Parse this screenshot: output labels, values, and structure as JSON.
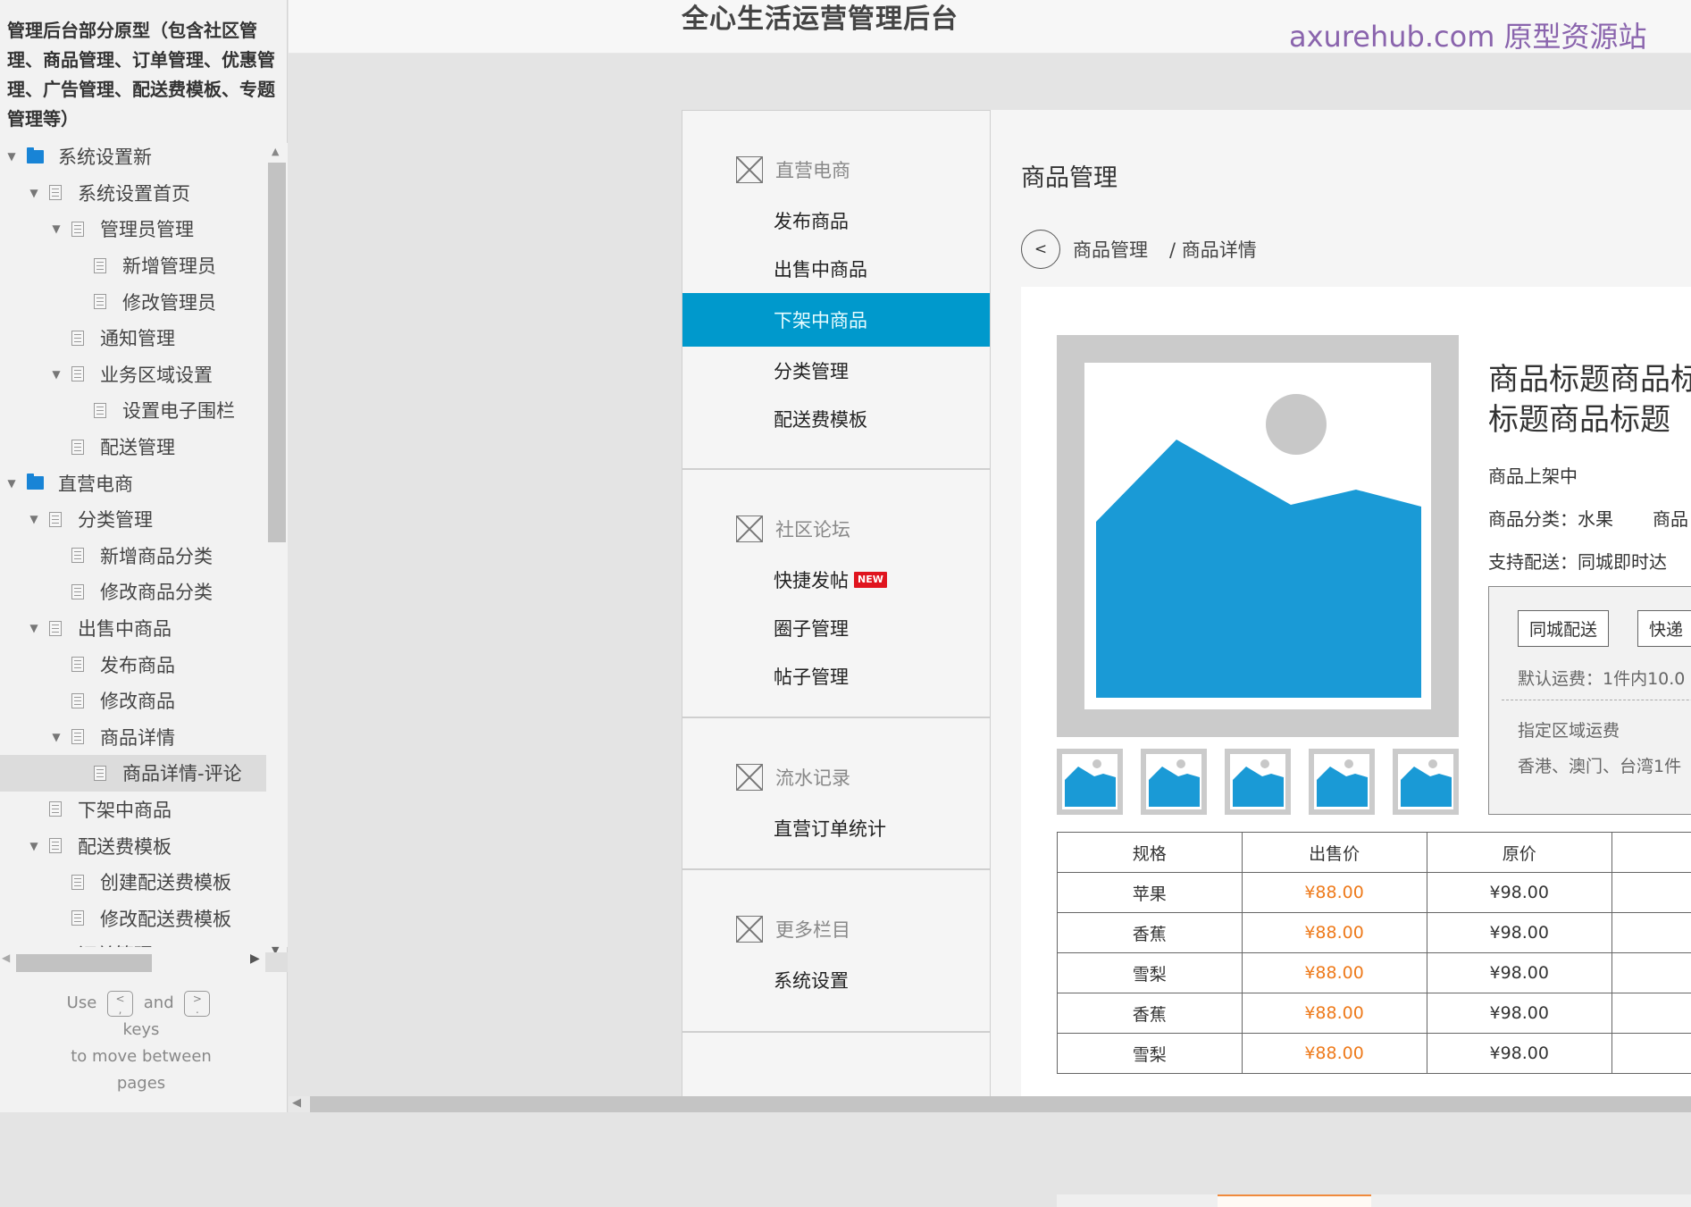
{
  "sitemap": {
    "title": "管理后台部分原型（包含社区管理、商品管理、订单管理、优惠管理、广告管理、配送费模板、专题管理等）",
    "items": [
      {
        "label": "系统设置新",
        "level": 0,
        "type": "folder",
        "expanded": true
      },
      {
        "label": "系统设置首页",
        "level": 1,
        "type": "page",
        "expanded": true
      },
      {
        "label": "管理员管理",
        "level": 2,
        "type": "page",
        "expanded": true
      },
      {
        "label": "新增管理员",
        "level": 3,
        "type": "page"
      },
      {
        "label": "修改管理员",
        "level": 3,
        "type": "page"
      },
      {
        "label": "通知管理",
        "level": 2,
        "type": "page"
      },
      {
        "label": "业务区域设置",
        "level": 2,
        "type": "page",
        "expanded": true
      },
      {
        "label": "设置电子围栏",
        "level": 3,
        "type": "page"
      },
      {
        "label": "配送管理",
        "level": 2,
        "type": "page"
      },
      {
        "label": "直营电商",
        "level": 0,
        "type": "folder",
        "expanded": true
      },
      {
        "label": "分类管理",
        "level": 1,
        "type": "page",
        "expanded": true
      },
      {
        "label": "新增商品分类",
        "level": 2,
        "type": "page"
      },
      {
        "label": "修改商品分类",
        "level": 2,
        "type": "page"
      },
      {
        "label": "出售中商品",
        "level": 1,
        "type": "page",
        "expanded": true
      },
      {
        "label": "发布商品",
        "level": 2,
        "type": "page"
      },
      {
        "label": "修改商品",
        "level": 2,
        "type": "page"
      },
      {
        "label": "商品详情",
        "level": 2,
        "type": "page",
        "expanded": true
      },
      {
        "label": "商品详情-评论",
        "level": 3,
        "type": "page",
        "selected": true
      },
      {
        "label": "下架中商品",
        "level": 1,
        "type": "page"
      },
      {
        "label": "配送费模板",
        "level": 1,
        "type": "page",
        "expanded": true
      },
      {
        "label": "创建配送费模板",
        "level": 2,
        "type": "page"
      },
      {
        "label": "修改配送费模板",
        "level": 2,
        "type": "page"
      },
      {
        "label": "订单管理",
        "level": 1,
        "type": "page",
        "expanded": true
      }
    ],
    "hint": {
      "use": "Use",
      "key_prev_top": "<",
      "key_prev_bottom": ",",
      "and": "and",
      "key_next_top": ">",
      "key_next_bottom": ".",
      "keys": "keys",
      "move": "to move between",
      "pages": "pages"
    }
  },
  "header": {
    "app_title": "全心生活运营管理后台",
    "watermark": "axurehub.com 原型资源站"
  },
  "nav": {
    "sections": [
      {
        "title": "直营电商",
        "items": [
          {
            "label": "发布商品"
          },
          {
            "label": "出售中商品"
          },
          {
            "label": "下架中商品",
            "active": true
          },
          {
            "label": "分类管理"
          },
          {
            "label": "配送费模板"
          }
        ]
      },
      {
        "title": "社区论坛",
        "items": [
          {
            "label": "快捷发帖",
            "badge": "NEW"
          },
          {
            "label": "圈子管理"
          },
          {
            "label": "帖子管理"
          }
        ]
      },
      {
        "title": "流水记录",
        "items": [
          {
            "label": "直营订单统计"
          }
        ]
      },
      {
        "title": "更多栏目",
        "items": [
          {
            "label": "系统设置"
          }
        ]
      }
    ]
  },
  "content": {
    "page_title": "商品管理",
    "breadcrumb": {
      "back_icon": "<",
      "parent": "商品管理",
      "current": "/ 商品详情"
    },
    "product": {
      "title_line1": "商品标题商品标",
      "title_line2": "标题商品标题",
      "status": "商品上架中",
      "category_label": "商品分类：",
      "category_value": "水果",
      "category_extra": "商品",
      "delivery_label": "支持配送：",
      "delivery_value": "同城即时达"
    },
    "shipping": {
      "tabs": [
        "同城配送",
        "快递"
      ],
      "default_fee": "默认运费：1件内10.0",
      "area_label": "指定区域运费",
      "area_value": "香港、澳门、台湾1件"
    },
    "spec_table": {
      "headers": [
        "规格",
        "出售价",
        "原价",
        ""
      ],
      "rows": [
        [
          "苹果",
          "¥88.00",
          "¥98.00",
          ""
        ],
        [
          "香蕉",
          "¥88.00",
          "¥98.00",
          ""
        ],
        [
          "雪梨",
          "¥88.00",
          "¥98.00",
          ""
        ],
        [
          "香蕉",
          "¥88.00",
          "¥98.00",
          ""
        ],
        [
          "雪梨",
          "¥88.00",
          "¥98.00",
          ""
        ]
      ]
    },
    "thumbnail_count": 5
  },
  "colors": {
    "accent": "#0099cc",
    "price": "#ee7a1b",
    "new_badge": "#e0141e",
    "folder": "#1884d6",
    "watermark": "#8a64ad",
    "image_blue": "#1a9ad6"
  }
}
